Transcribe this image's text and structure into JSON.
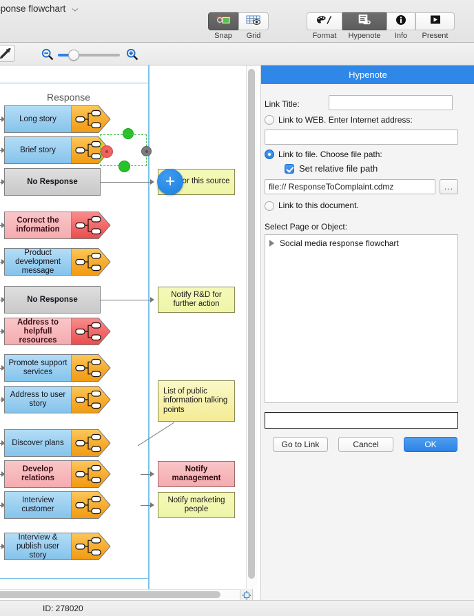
{
  "titlebar": {
    "document_title": "sponse flowchart",
    "chevron_icon": "chevron-down-icon",
    "tools": [
      {
        "label": "Snap",
        "icon": "snap-icon",
        "active": true
      },
      {
        "label": "Grid",
        "icon": "grid-eye-icon",
        "active": false
      }
    ],
    "modes": [
      {
        "label": "Format",
        "icon": "palette-icon",
        "active": false
      },
      {
        "label": "Hypenote",
        "icon": "note-link-icon",
        "active": true
      },
      {
        "label": "Info",
        "icon": "info-icon",
        "active": false
      },
      {
        "label": "Present",
        "icon": "play-icon",
        "active": false
      }
    ]
  },
  "zoombar": {
    "eyedropper_icon": "eyedropper-icon",
    "zoom_out_icon": "magnifier-minus-icon",
    "zoom_in_icon": "magnifier-plus-icon"
  },
  "canvas": {
    "lane_title": "Response",
    "add_button_label": "+",
    "nodes": [
      {
        "label": "Long story",
        "style": "blue",
        "tag": "orange"
      },
      {
        "label": "Brief story",
        "style": "blue",
        "tag": "orange",
        "selected": true
      },
      {
        "label": "No Response",
        "style": "grey",
        "tag": "none"
      },
      {
        "label": "Correct the information",
        "style": "pink",
        "tag": "red"
      },
      {
        "label": "Product development message",
        "style": "blue",
        "tag": "orange"
      },
      {
        "label": "No Response",
        "style": "grey",
        "tag": "none"
      },
      {
        "label": "Address to helpfull resources",
        "style": "pink",
        "tag": "red"
      },
      {
        "label": "Promote support services",
        "style": "blue",
        "tag": "orange"
      },
      {
        "label": "Address to user story",
        "style": "blue",
        "tag": "orange"
      },
      {
        "label": "Discover plans",
        "style": "blue",
        "tag": "orange"
      },
      {
        "label": "Develop relations",
        "style": "pink",
        "tag": "orange"
      },
      {
        "label": "Interview customer",
        "style": "blue",
        "tag": "orange"
      },
      {
        "label": "Interview & publish user story",
        "style": "blue",
        "tag": "orange"
      }
    ],
    "right_boxes": [
      {
        "label": "Monitor this source",
        "style": "yellowgreen"
      },
      {
        "label": "Notify R&D for further action",
        "style": "yellowgreen"
      },
      {
        "label": "List of public information talking points",
        "style": "yellow"
      },
      {
        "label": "Notify management",
        "style": "pinkbox"
      },
      {
        "label": "Notify marketing people",
        "style": "yellowgreen"
      }
    ]
  },
  "statusbar": {
    "id_text": "ID: 278020"
  },
  "panel": {
    "title": "Hypenote",
    "link_title_label": "Link Title:",
    "link_title_value": "",
    "link_title_placeholder": "",
    "web_radio_label": "Link to WEB. Enter Internet address:",
    "web_radio_selected": false,
    "web_address_value": "",
    "file_radio_label": "Link to file. Choose file path:",
    "file_radio_selected": true,
    "relative_path_label": "Set relative file path",
    "relative_path_checked": true,
    "file_path_value": "file:// ResponseToComplaint.cdmz",
    "browse_button_label": "...",
    "document_radio_label": "Link to this document.",
    "document_radio_selected": false,
    "select_page_label": "Select Page or Object:",
    "tree_items": [
      {
        "label": "Social media response flowchart",
        "expander_icon": "triangle-right-icon"
      }
    ],
    "focus_field_value": "",
    "buttons": {
      "go_to_link": "Go to Link",
      "cancel": "Cancel",
      "ok": "OK"
    }
  },
  "colors": {
    "accent": "#2f88e8",
    "panel_bg": "#f4f4f4",
    "page_border": "#79c3e8",
    "node_blue": "#9ed0f0",
    "node_pink": "#f7b9bc",
    "node_grey": "#d3d3d3",
    "tag_orange": "#f5a723",
    "tag_red": "#ef5a5a",
    "handle_green": "#27c427",
    "handle_red": "#f0625c"
  }
}
